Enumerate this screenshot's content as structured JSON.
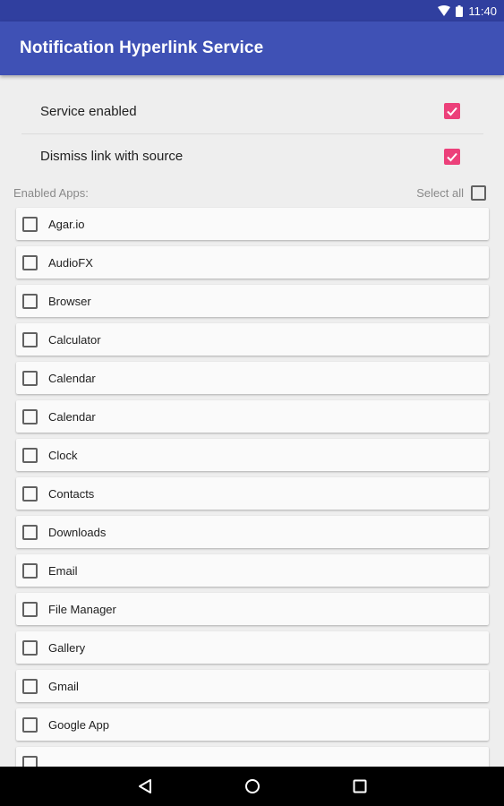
{
  "status_bar": {
    "time": "11:40",
    "icons": [
      "wifi-icon",
      "battery-icon"
    ]
  },
  "app_bar": {
    "title": "Notification Hyperlink Service",
    "color": "#3f51b5"
  },
  "preferences": [
    {
      "label": "Service enabled",
      "checked": true
    },
    {
      "label": "Dismiss link with source",
      "checked": true
    }
  ],
  "apps_section": {
    "label": "Enabled Apps:",
    "select_all_label": "Select all",
    "select_all_checked": false
  },
  "apps": [
    {
      "name": "Agar.io",
      "checked": false
    },
    {
      "name": "AudioFX",
      "checked": false
    },
    {
      "name": "Browser",
      "checked": false
    },
    {
      "name": "Calculator",
      "checked": false
    },
    {
      "name": "Calendar",
      "checked": false
    },
    {
      "name": "Calendar",
      "checked": false
    },
    {
      "name": "Clock",
      "checked": false
    },
    {
      "name": "Contacts",
      "checked": false
    },
    {
      "name": "Downloads",
      "checked": false
    },
    {
      "name": "Email",
      "checked": false
    },
    {
      "name": "File Manager",
      "checked": false
    },
    {
      "name": "Gallery",
      "checked": false
    },
    {
      "name": "Gmail",
      "checked": false
    },
    {
      "name": "Google App",
      "checked": false
    },
    {
      "name": "",
      "checked": false
    }
  ],
  "nav_bar": {
    "buttons": [
      "back-icon",
      "home-icon",
      "recents-icon"
    ]
  },
  "colors": {
    "accent": "#ec407a",
    "primary": "#3f51b5",
    "primary_dark": "#303f9f"
  }
}
